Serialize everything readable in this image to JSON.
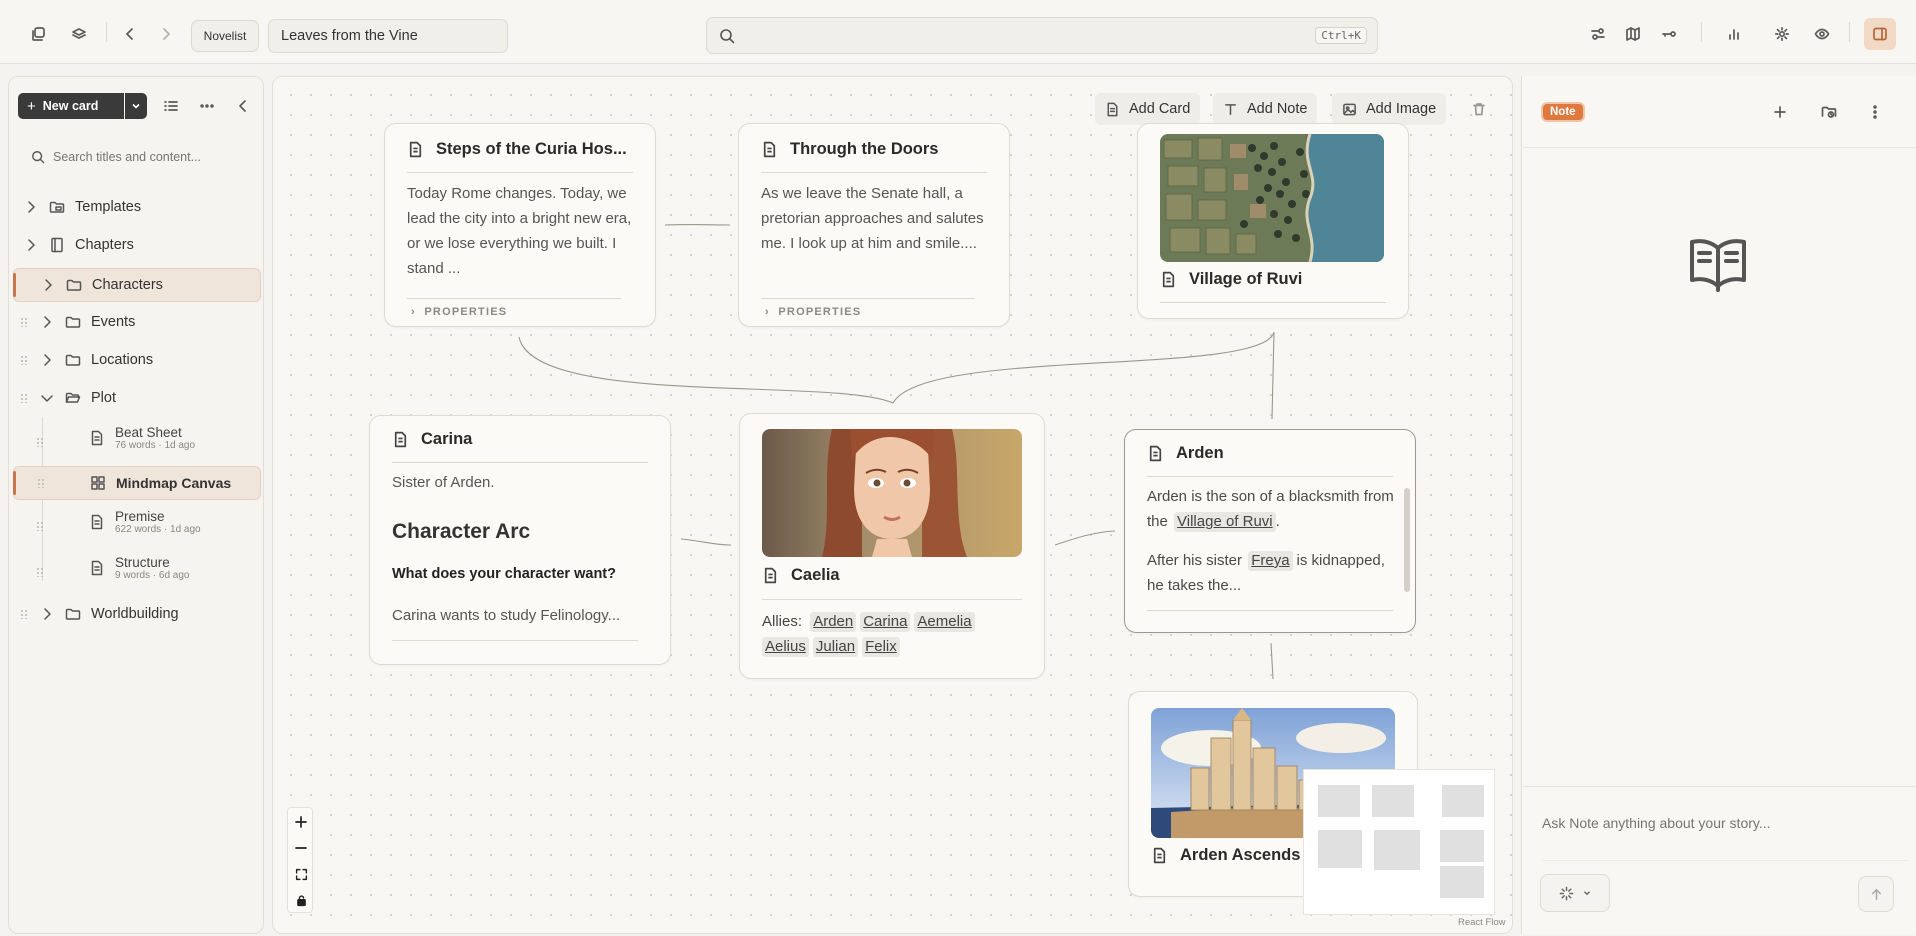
{
  "topbar": {
    "app_badge": "Novelist",
    "project_name": "Leaves from the Vine",
    "search_shortcut": "Ctrl+K"
  },
  "sidebar": {
    "new_card_label": "New card",
    "search_placeholder": "Search titles and content...",
    "items": [
      {
        "label": "Templates"
      },
      {
        "label": "Chapters"
      },
      {
        "label": "Characters"
      },
      {
        "label": "Events"
      },
      {
        "label": "Locations"
      },
      {
        "label": "Plot"
      },
      {
        "label": "Beat Sheet",
        "meta": "76 words · 1d ago"
      },
      {
        "label": "Mindmap Canvas"
      },
      {
        "label": "Premise",
        "meta": "622 words · 1d ago"
      },
      {
        "label": "Structure",
        "meta": "9 words · 6d ago"
      },
      {
        "label": "Worldbuilding"
      }
    ]
  },
  "canvas": {
    "toolbar": {
      "add_card": "Add Card",
      "add_note": "Add Note",
      "add_image": "Add Image"
    },
    "properties_label": "PROPERTIES",
    "cards": {
      "steps": {
        "title": "Steps of the Curia Hos...",
        "body": "Today Rome changes. Today, we lead the city into a bright new era, or we lose everything we built. I stand ..."
      },
      "doors": {
        "title": "Through the Doors",
        "body": "As we leave the Senate hall, a pretorian approaches and salutes me. I look up at him and smile...."
      },
      "ruvi": {
        "title": "Village of Ruvi"
      },
      "carina": {
        "title": "Carina",
        "intro": "Sister of Arden.",
        "heading": "Character Arc",
        "question": "What does your character want?",
        "answer": "Carina wants to study Felinology..."
      },
      "caelia": {
        "title": "Caelia",
        "allies_label": "Allies:",
        "allies": [
          "Arden",
          "Carina",
          "Aemelia",
          "Aelius",
          "Julian",
          "Felix"
        ]
      },
      "arden": {
        "title": "Arden",
        "p1_a": "Arden is the son of a blacksmith from the",
        "p1_link": "Village of Ruvi",
        "p1_b": ".",
        "p2_a": "After his sister",
        "p2_link": "Freya",
        "p2_b": "is kidnapped, he takes the..."
      },
      "ascends": {
        "title": "Arden Ascends"
      }
    },
    "attribution": "React Flow"
  },
  "rightpanel": {
    "badge": "Note",
    "ask_placeholder": "Ask Note anything about your story..."
  },
  "colors": {
    "accent": "#e0793f",
    "selection_bg": "#efe5db",
    "sea": "#4f8597"
  }
}
